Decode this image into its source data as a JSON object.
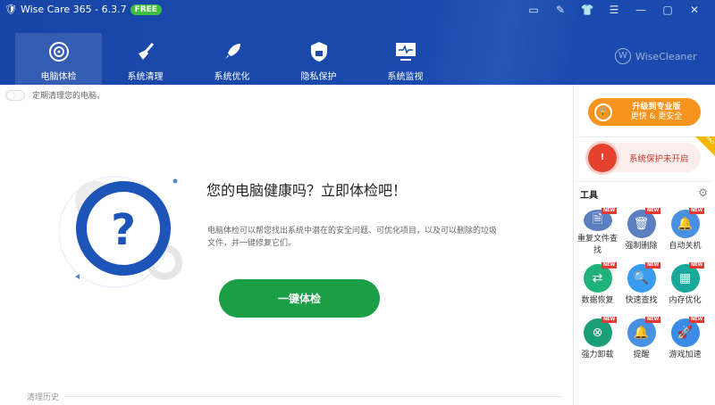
{
  "app": {
    "title": "Wise Care 365 - 6.3.7",
    "badge": "FREE",
    "brand": "WiseCleaner"
  },
  "window_icons": [
    "feedback-icon",
    "edit-icon",
    "skin-icon",
    "menu-icon",
    "minimize-icon",
    "maximize-icon",
    "close-icon"
  ],
  "nav": [
    {
      "label": "电脑体检",
      "active": true
    },
    {
      "label": "系统清理"
    },
    {
      "label": "系统优化"
    },
    {
      "label": "隐私保护"
    },
    {
      "label": "系统监视"
    }
  ],
  "toggle": {
    "label": "定期清理您的电脑。",
    "on": false
  },
  "main": {
    "title": "您的电脑健康吗？立即体检吧！",
    "description": "电脑体检可以帮您找出系统中潜在的安全问题、可优化项目，以及可以删除的垃圾文件，并一键修复它们。",
    "scan_button": "一键体检",
    "history": "清理历史"
  },
  "sidebar": {
    "upgrade": {
      "line1": "升级到专业版",
      "line2": "更快 & 更安全"
    },
    "protection": {
      "label": "系统保护未开启",
      "badge": "PRO"
    },
    "tools_title": "工具",
    "tools": [
      {
        "label": "重复文件查找",
        "badge": "NEW",
        "color": "#5b7fc0"
      },
      {
        "label": "强制删除",
        "badge": "NEW",
        "color": "#5b7fc0"
      },
      {
        "label": "自动关机",
        "badge": "NEW",
        "color": "#4a90e2"
      },
      {
        "label": "数据恢复",
        "badge": "NEW",
        "color": "#1fb37a"
      },
      {
        "label": "快速查找",
        "badge": "NEW",
        "color": "#3a9cf0"
      },
      {
        "label": "内存优化",
        "badge": "NEW",
        "color": "#1aa89a"
      },
      {
        "label": "强力卸载",
        "badge": "NEW",
        "color": "#1a9e7a"
      },
      {
        "label": "提醒",
        "badge": "NEW",
        "color": "#4a90e2"
      },
      {
        "label": "游戏加速",
        "badge": "NEW",
        "color": "#3a8ae8"
      }
    ]
  }
}
